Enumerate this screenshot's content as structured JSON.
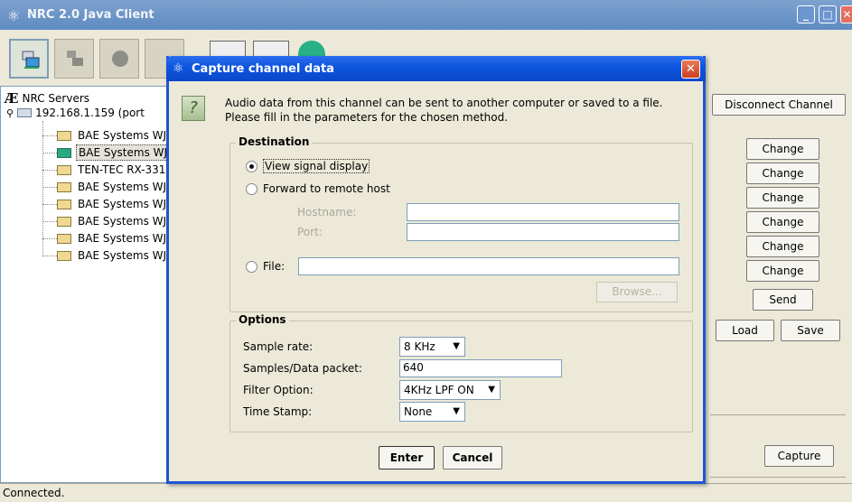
{
  "window": {
    "title": "NRC 2.0 Java Client"
  },
  "tree": {
    "root": "NRC Servers",
    "host": "192.168.1.159 (port",
    "items": [
      {
        "label": "BAE Systems WJ",
        "selected": false,
        "active": false
      },
      {
        "label": "BAE Systems WJ",
        "selected": true,
        "active": true
      },
      {
        "label": "TEN-TEC RX-331",
        "selected": false,
        "active": false
      },
      {
        "label": "BAE Systems WJ",
        "selected": false,
        "active": false
      },
      {
        "label": "BAE Systems WJ",
        "selected": false,
        "active": false
      },
      {
        "label": "BAE Systems WJ",
        "selected": false,
        "active": false
      },
      {
        "label": "BAE Systems WJ",
        "selected": false,
        "active": false
      },
      {
        "label": "BAE Systems WJ",
        "selected": false,
        "active": false
      }
    ]
  },
  "right": {
    "disconnect": "Disconnect Channel",
    "change_buttons": [
      "Change",
      "Change",
      "Change",
      "Change",
      "Change",
      "Change"
    ],
    "send": "Send",
    "load": "Load",
    "save": "Save",
    "capture": "Capture"
  },
  "status": "Connected.",
  "dialog": {
    "title": "Capture channel data",
    "info_line1": "Audio data from this channel can be sent to another computer or saved to a file.",
    "info_line2": "Please fill in the parameters for the chosen method.",
    "destination": {
      "legend": "Destination",
      "view_signal": "View signal display",
      "forward": "Forward to remote host",
      "hostname_label": "Hostname:",
      "port_label": "Port:",
      "hostname_value": "",
      "port_value": "",
      "file_label": "File:",
      "file_value": "",
      "browse": "Browse..."
    },
    "options": {
      "legend": "Options",
      "sample_rate_label": "Sample rate:",
      "sample_rate_value": "8 KHz",
      "samples_label": "Samples/Data packet:",
      "samples_value": "640",
      "filter_label": "Filter Option:",
      "filter_value": "4KHz LPF ON",
      "timestamp_label": "Time Stamp:",
      "timestamp_value": "None"
    },
    "enter": "Enter",
    "cancel": "Cancel"
  }
}
